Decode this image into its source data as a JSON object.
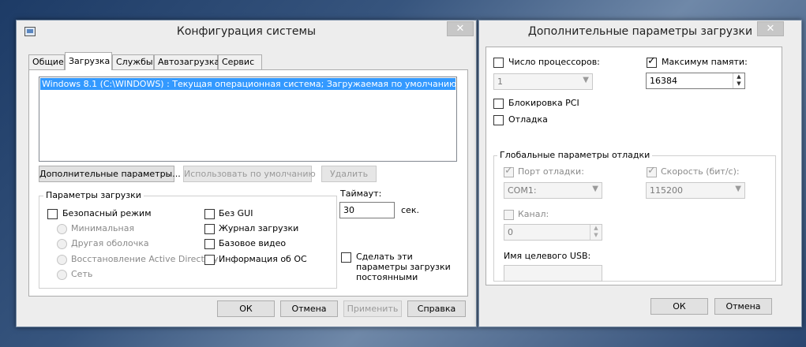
{
  "left_window": {
    "title": "Конфигурация системы",
    "close": "✕",
    "tabs": [
      "Общие",
      "Загрузка",
      "Службы",
      "Автозагрузка",
      "Сервис"
    ],
    "boot_list": [
      "Windows 8.1 (C:\\WINDOWS) : Текущая операционная система; Загружаемая по умолчанию ОС"
    ],
    "btn_advanced": "Дополнительные параметры...",
    "btn_default": "Использовать по умолчанию",
    "btn_delete": "Удалить",
    "boot_options_title": "Параметры загрузки",
    "safe_mode": "Безопасный режим",
    "minimal": "Минимальная",
    "alt_shell": "Другая оболочка",
    "ad_repair": "Восстановление Active Directory",
    "network": "Сеть",
    "no_gui": "Без GUI",
    "boot_log": "Журнал загрузки",
    "base_video": "Базовое видео",
    "os_info": "Информация  об ОС",
    "timeout_label": "Таймаут:",
    "timeout_value": "30",
    "timeout_unit": "сек.",
    "make_permanent": "Сделать эти параметры загрузки постоянными",
    "btn_ok": "ОК",
    "btn_cancel": "Отмена",
    "btn_apply": "Применить",
    "btn_help": "Справка"
  },
  "right_window": {
    "title": "Дополнительные параметры загрузки",
    "close": "✕",
    "num_processors": "Число процессоров:",
    "num_processors_checked": false,
    "processors_value": "1",
    "max_memory": "Максимум памяти:",
    "max_memory_checked": true,
    "memory_value": "16384",
    "pci_lock": "Блокировка PCI",
    "debug": "Отладка",
    "global_debug_title": "Глобальные параметры отладки",
    "debug_port": "Порт отладки:",
    "debug_port_value": "COM1:",
    "baud_rate": "Скорость (бит/с):",
    "baud_rate_value": "115200",
    "channel": "Канал:",
    "channel_value": "0",
    "usb_target": "Имя целевого USB:",
    "usb_value": "",
    "btn_ok": "ОК",
    "btn_cancel": "Отмена"
  }
}
